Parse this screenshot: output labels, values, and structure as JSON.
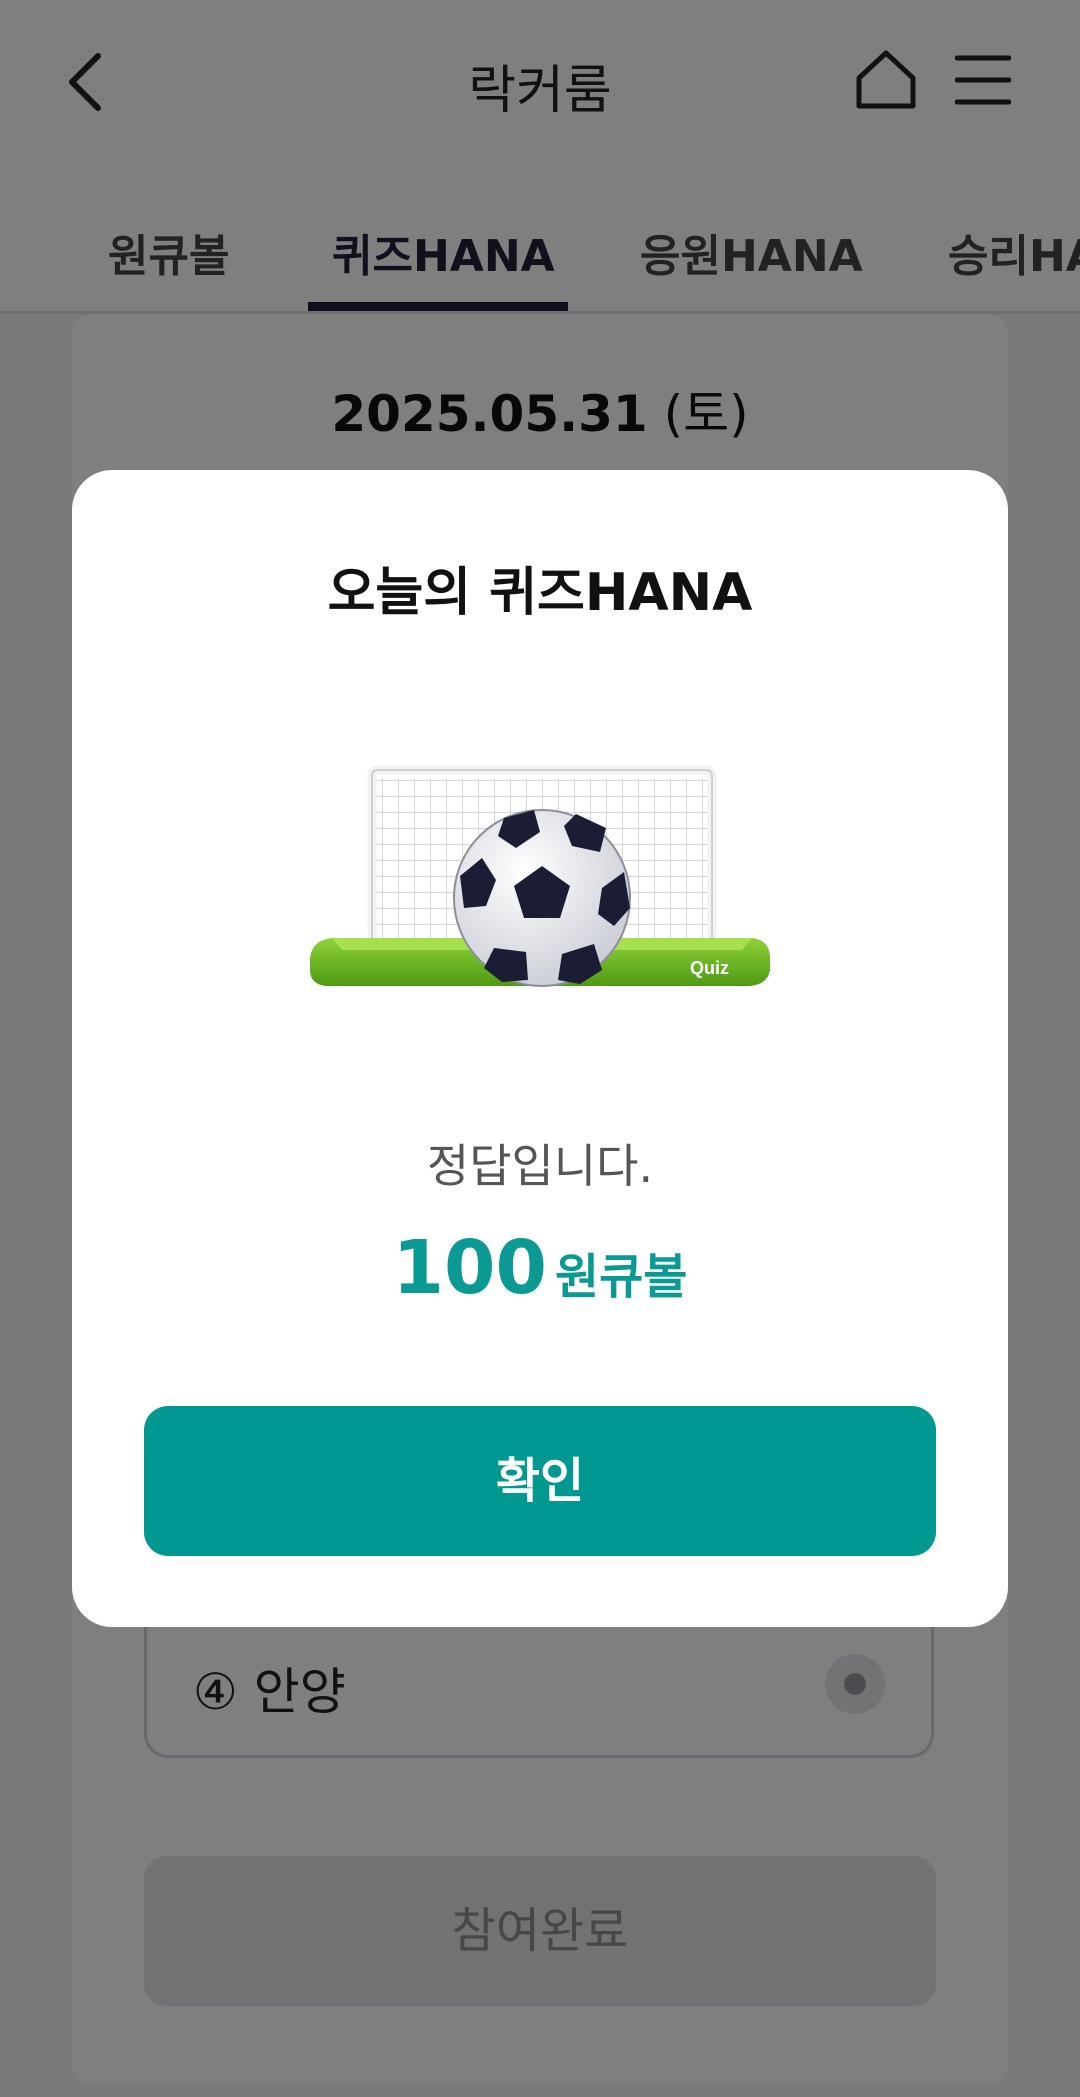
{
  "header": {
    "title": "락커룸",
    "back_icon": "chevron-left-icon",
    "home_icon": "home-icon",
    "menu_icon": "hamburger-menu-icon"
  },
  "tabs": [
    {
      "label": "원큐볼",
      "active": false
    },
    {
      "label": "퀴즈HANA",
      "active": true
    },
    {
      "label": "응원HANA",
      "active": false
    },
    {
      "label": "승리HANA",
      "active": false
    }
  ],
  "quiz": {
    "date": "2025.05.31",
    "weekday": "(토)",
    "option": {
      "label": "④ 안양"
    },
    "done_label": "참여완료"
  },
  "modal": {
    "title": "오늘의 퀴즈HANA",
    "image_badge": "Quiz",
    "result_text": "정답입니다.",
    "reward_amount": "100",
    "reward_unit": "원큐볼",
    "confirm_label": "확인"
  },
  "colors": {
    "accent": "#009891",
    "reward": "#0b9a93",
    "tab_indicator": "#1c1c3a"
  }
}
